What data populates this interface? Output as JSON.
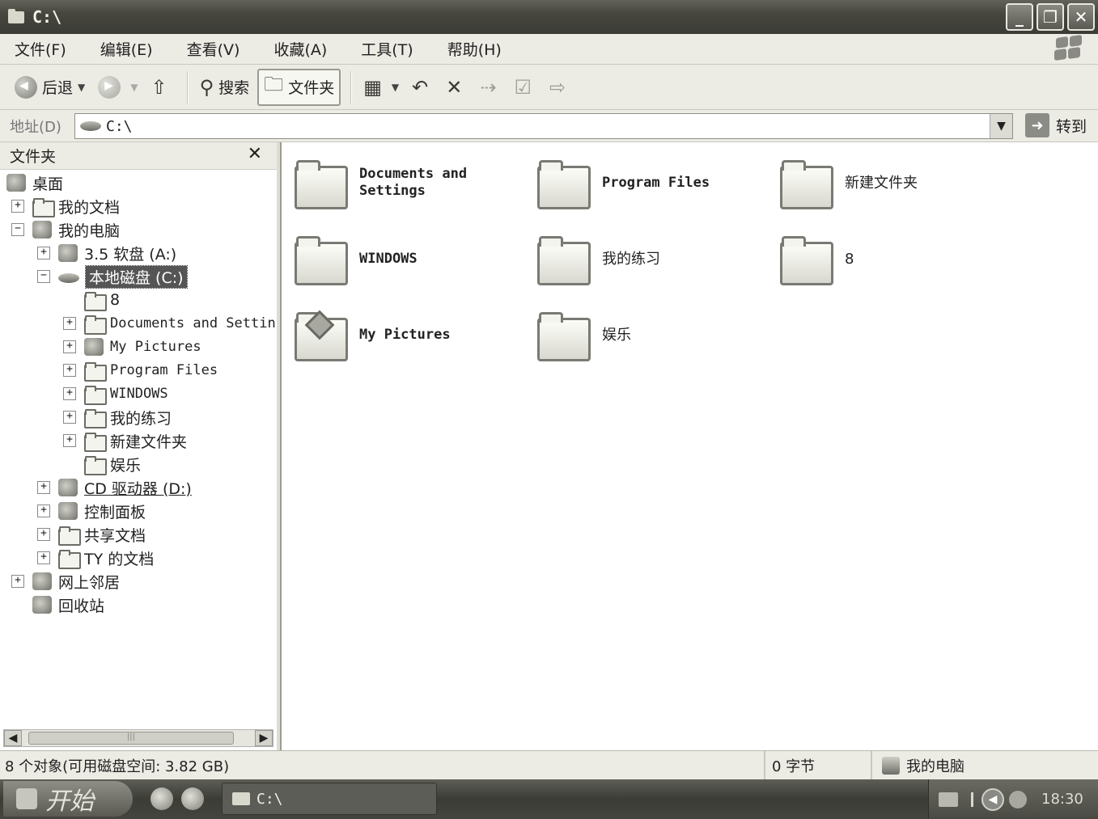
{
  "window": {
    "title": "C:\\"
  },
  "menu": [
    "文件(F)",
    "编辑(E)",
    "查看(V)",
    "收藏(A)",
    "工具(T)",
    "帮助(H)"
  ],
  "toolbar": {
    "back": "后退",
    "search": "搜索",
    "folders": "文件夹"
  },
  "address": {
    "label": "地址(D)",
    "value": "C:\\",
    "go": "转到"
  },
  "folder_pane": {
    "title": "文件夹",
    "tree": [
      {
        "label": "桌面"
      },
      {
        "label": "我的文档"
      },
      {
        "label": "我的电脑"
      },
      {
        "label": "3.5 软盘 (A:)"
      },
      {
        "label": "本地磁盘 (C:)"
      },
      {
        "label": "8"
      },
      {
        "label": "Documents and Settin"
      },
      {
        "label": "My Pictures"
      },
      {
        "label": "Program Files"
      },
      {
        "label": "WINDOWS"
      },
      {
        "label": "我的练习"
      },
      {
        "label": "新建文件夹"
      },
      {
        "label": "娱乐"
      },
      {
        "label": "CD 驱动器 (D:)"
      },
      {
        "label": "控制面板"
      },
      {
        "label": "共享文档"
      },
      {
        "label": "TY 的文档"
      },
      {
        "label": "网上邻居"
      },
      {
        "label": "回收站"
      }
    ]
  },
  "content": {
    "items": [
      {
        "label": "Documents and Settings"
      },
      {
        "label": "Program Files"
      },
      {
        "label": "新建文件夹"
      },
      {
        "label": "WINDOWS"
      },
      {
        "label": "我的练习"
      },
      {
        "label": "8"
      },
      {
        "label": "My Pictures"
      },
      {
        "label": "娱乐"
      }
    ]
  },
  "status": {
    "objects": "8 个对象(可用磁盘空间: 3.82 GB)",
    "size": "0 字节",
    "location": "我的电脑"
  },
  "taskbar": {
    "start": "开始",
    "task": "C:\\",
    "clock": "18:30"
  }
}
